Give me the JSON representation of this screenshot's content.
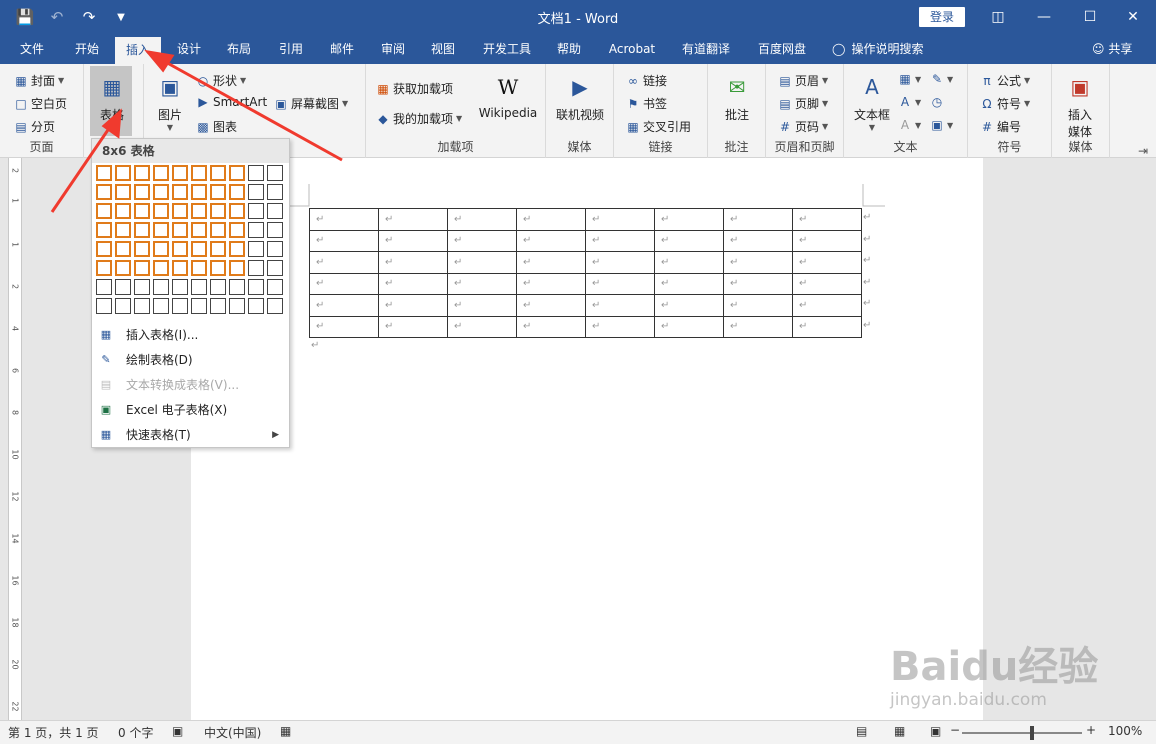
{
  "window": {
    "title": "文档1 - Word",
    "login_label": "登录",
    "share_label": "共享",
    "tell_me": "操作说明搜索"
  },
  "tabs": [
    "文件",
    "开始",
    "插入",
    "设计",
    "布局",
    "引用",
    "邮件",
    "审阅",
    "视图",
    "开发工具",
    "帮助",
    "Acrobat",
    "有道翻译",
    "百度网盘"
  ],
  "active_tab": "插入",
  "ribbon": {
    "pages": {
      "label": "页面",
      "cover": "封面",
      "blank": "空白页",
      "break": "分页"
    },
    "tables": {
      "label": "表格"
    },
    "illustrations": {
      "picture": "图片",
      "shapes": "形状",
      "smartart": "SmartArt",
      "chart": "图表",
      "screenshot": "屏幕截图"
    },
    "addins": {
      "label": "加载项",
      "get": "获取加载项",
      "mine": "我的加载项",
      "wikipedia": "Wikipedia"
    },
    "media": {
      "label": "媒体",
      "online_video": "联机视频"
    },
    "links": {
      "label": "链接",
      "link": "链接",
      "bookmark": "书签",
      "cross_ref": "交叉引用"
    },
    "comments": {
      "label": "批注",
      "comment": "批注"
    },
    "header_footer": {
      "label": "页眉和页脚",
      "header": "页眉",
      "footer": "页脚",
      "page_number": "页码"
    },
    "text": {
      "label": "文本",
      "textbox": "文本框"
    },
    "symbols": {
      "label": "符号",
      "equation": "公式",
      "symbol": "符号",
      "number": "编号"
    },
    "media2": {
      "label": "媒体",
      "insert_media_1": "插入",
      "insert_media_2": "媒体"
    }
  },
  "dropdown": {
    "title": "8x6 表格",
    "grid_cols": 10,
    "grid_rows": 8,
    "selected_cols": 8,
    "selected_rows": 6,
    "items": [
      {
        "label": "插入表格(I)...",
        "enabled": true
      },
      {
        "label": "绘制表格(D)",
        "enabled": true
      },
      {
        "label": "文本转换成表格(V)...",
        "enabled": false
      },
      {
        "label": "Excel 电子表格(X)",
        "enabled": true
      },
      {
        "label": "快速表格(T)",
        "enabled": true
      }
    ]
  },
  "ruler_numbers": [
    "2",
    "1",
    "1",
    "2",
    "4",
    "6",
    "8",
    "10",
    "12",
    "14",
    "16",
    "18",
    "20",
    "22",
    "24"
  ],
  "document": {
    "table_rows": 6,
    "table_cols": 8,
    "cell_mark": "↵"
  },
  "statusbar": {
    "page": "第 1 页，共 1 页",
    "words": "0 个字",
    "language": "中文(中国)",
    "zoom": "100%",
    "minus": "−",
    "plus": "+"
  },
  "watermark": {
    "logo": "Baidu经验",
    "url": "jingyan.baidu.com"
  }
}
